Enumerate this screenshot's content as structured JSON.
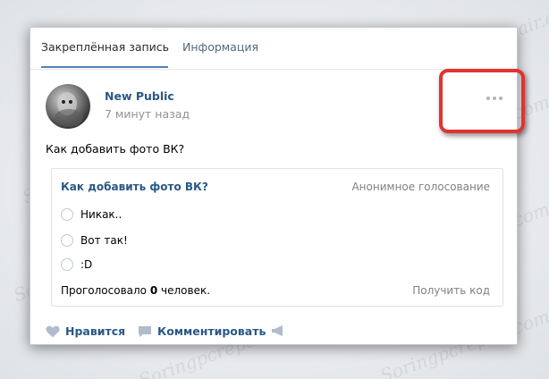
{
  "tabs": [
    {
      "label": "Закреплённая запись",
      "active": true
    },
    {
      "label": "Информация",
      "active": false
    }
  ],
  "post": {
    "author": "New Public",
    "time": "7 минут назад",
    "text": "Как добавить фото ВК?"
  },
  "poll": {
    "title": "Как добавить фото ВК?",
    "type": "Анонимное голосование",
    "options": [
      "Никак..",
      "Вот так!",
      ":D"
    ],
    "voted_prefix": "Проголосовало ",
    "voted_count": "0",
    "voted_suffix": " человек.",
    "get_code": "Получить код"
  },
  "actions": {
    "like": "Нравится",
    "comment": "Комментировать"
  },
  "colors": {
    "accent": "#5181b8",
    "link": "#2a5885",
    "highlight": "#e1332f"
  },
  "watermark": "Soringpcrepair.com"
}
